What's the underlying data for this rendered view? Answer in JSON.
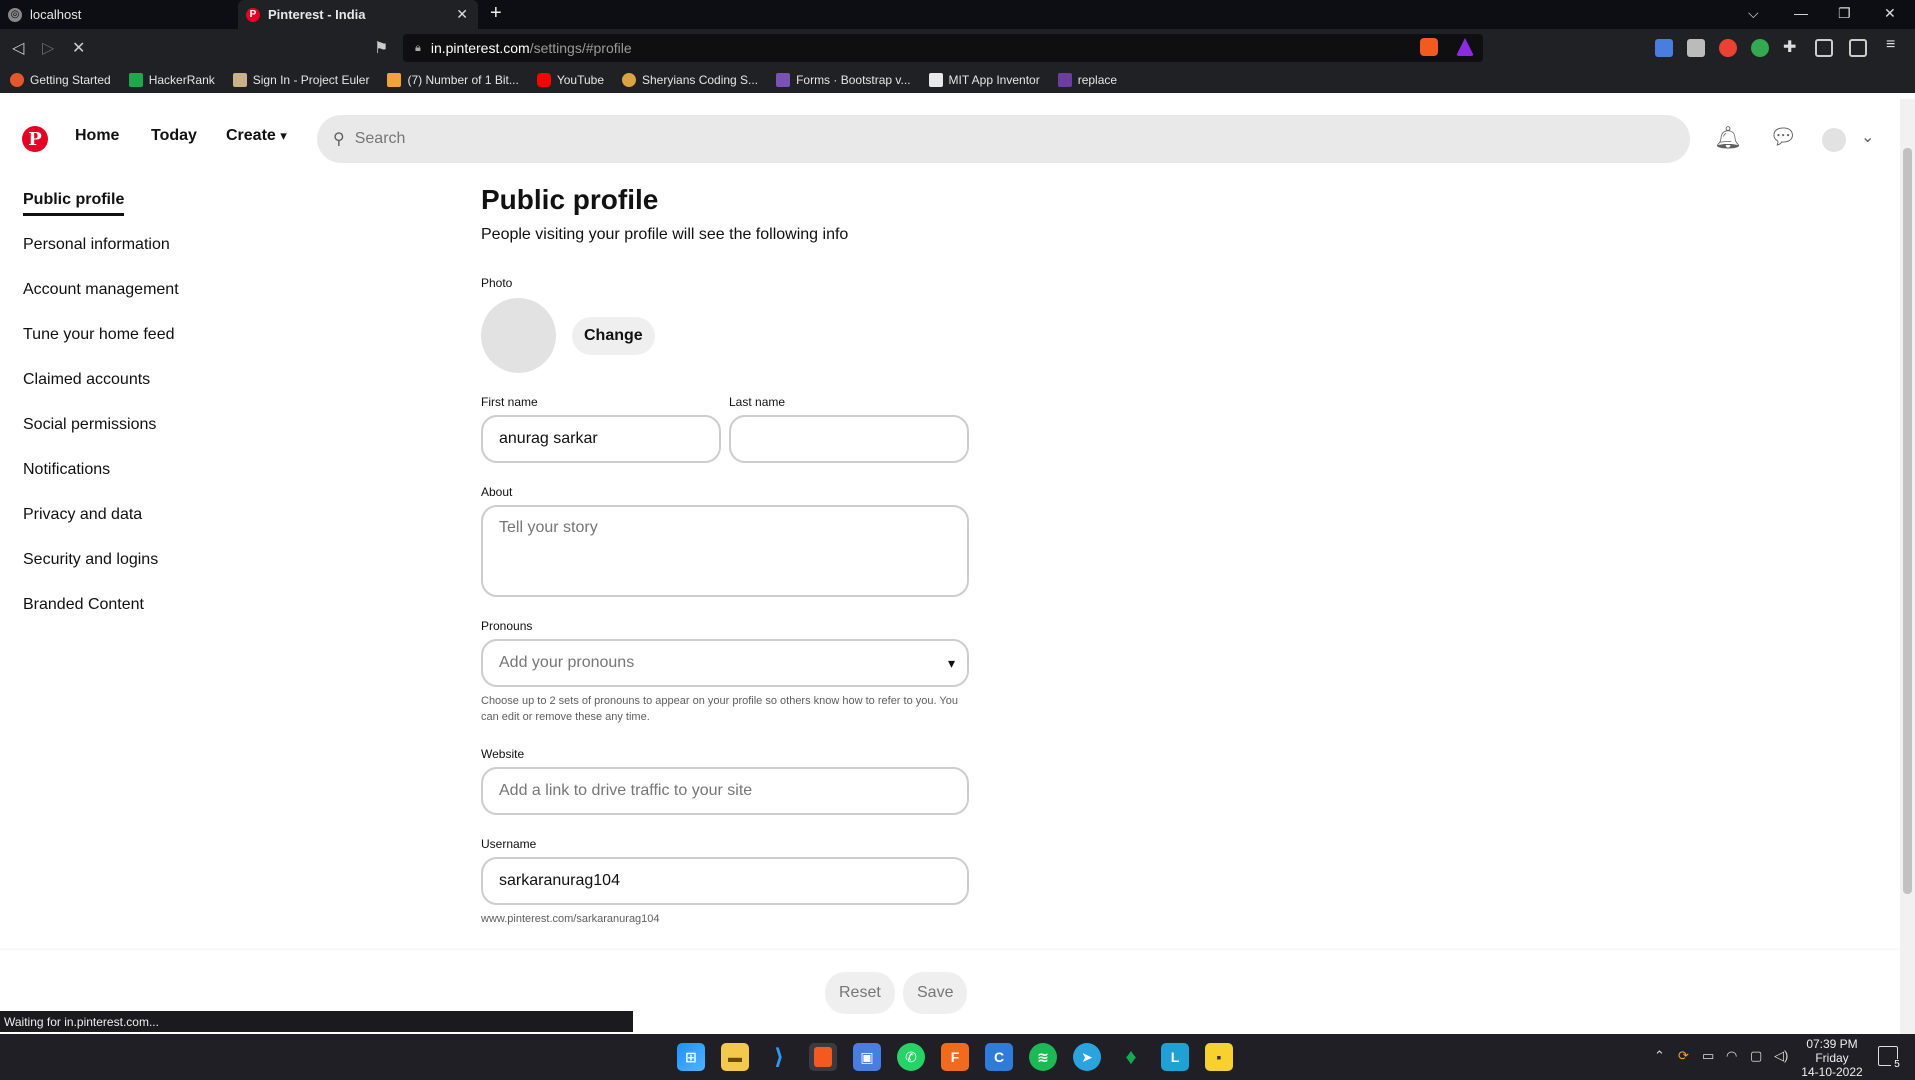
{
  "browser": {
    "tabs": [
      {
        "title": "localhost"
      },
      {
        "title": "Pinterest - India"
      }
    ],
    "url_host": "in.pinterest.com",
    "url_path": "/settings/#profile",
    "bookmarks": [
      {
        "label": "Getting Started",
        "color": "#e2582b"
      },
      {
        "label": "HackerRank",
        "color": "#1ba94c"
      },
      {
        "label": "Sign In - Project Euler",
        "color": "#c9b18a"
      },
      {
        "label": "(7) Number of 1 Bit...",
        "color": "#f0a23b"
      },
      {
        "label": "YouTube",
        "color": "#ff0000"
      },
      {
        "label": "Sheryians Coding S...",
        "color": "#d9a441"
      },
      {
        "label": "Forms · Bootstrap v...",
        "color": "#7952b3"
      },
      {
        "label": "MIT App Inventor",
        "color": "#e8e8e8"
      },
      {
        "label": "replace",
        "color": "#6b3fa0"
      }
    ],
    "status_text": "Waiting for in.pinterest.com..."
  },
  "header": {
    "logo": "P",
    "nav": {
      "home": "Home",
      "today": "Today",
      "create": "Create"
    },
    "search_placeholder": "Search"
  },
  "sidebar": {
    "items": [
      {
        "label": "Public profile",
        "active": true
      },
      {
        "label": "Personal information"
      },
      {
        "label": "Account management"
      },
      {
        "label": "Tune your home feed"
      },
      {
        "label": "Claimed accounts"
      },
      {
        "label": "Social permissions"
      },
      {
        "label": "Notifications"
      },
      {
        "label": "Privacy and data"
      },
      {
        "label": "Security and logins"
      },
      {
        "label": "Branded Content"
      }
    ]
  },
  "profile": {
    "title": "Public profile",
    "subtitle": "People visiting your profile will see the following info",
    "photo_label": "Photo",
    "change_label": "Change",
    "first_name_label": "First name",
    "first_name_value": "anurag sarkar",
    "last_name_label": "Last name",
    "last_name_value": "",
    "about_label": "About",
    "about_placeholder": "Tell your story",
    "pronouns_label": "Pronouns",
    "pronouns_placeholder": "Add your pronouns",
    "pronouns_help": "Choose up to 2 sets of pronouns to appear on your profile so others know how to refer to you. You can edit or remove these any time.",
    "website_label": "Website",
    "website_placeholder": "Add a link to drive traffic to your site",
    "username_label": "Username",
    "username_value": "sarkaranurag104",
    "profile_url": "www.pinterest.com/sarkaranurag104",
    "reset_label": "Reset",
    "save_label": "Save"
  },
  "taskbar": {
    "time": "07:39 PM",
    "day": "Friday",
    "date": "14-10-2022",
    "notification_count": "5"
  }
}
